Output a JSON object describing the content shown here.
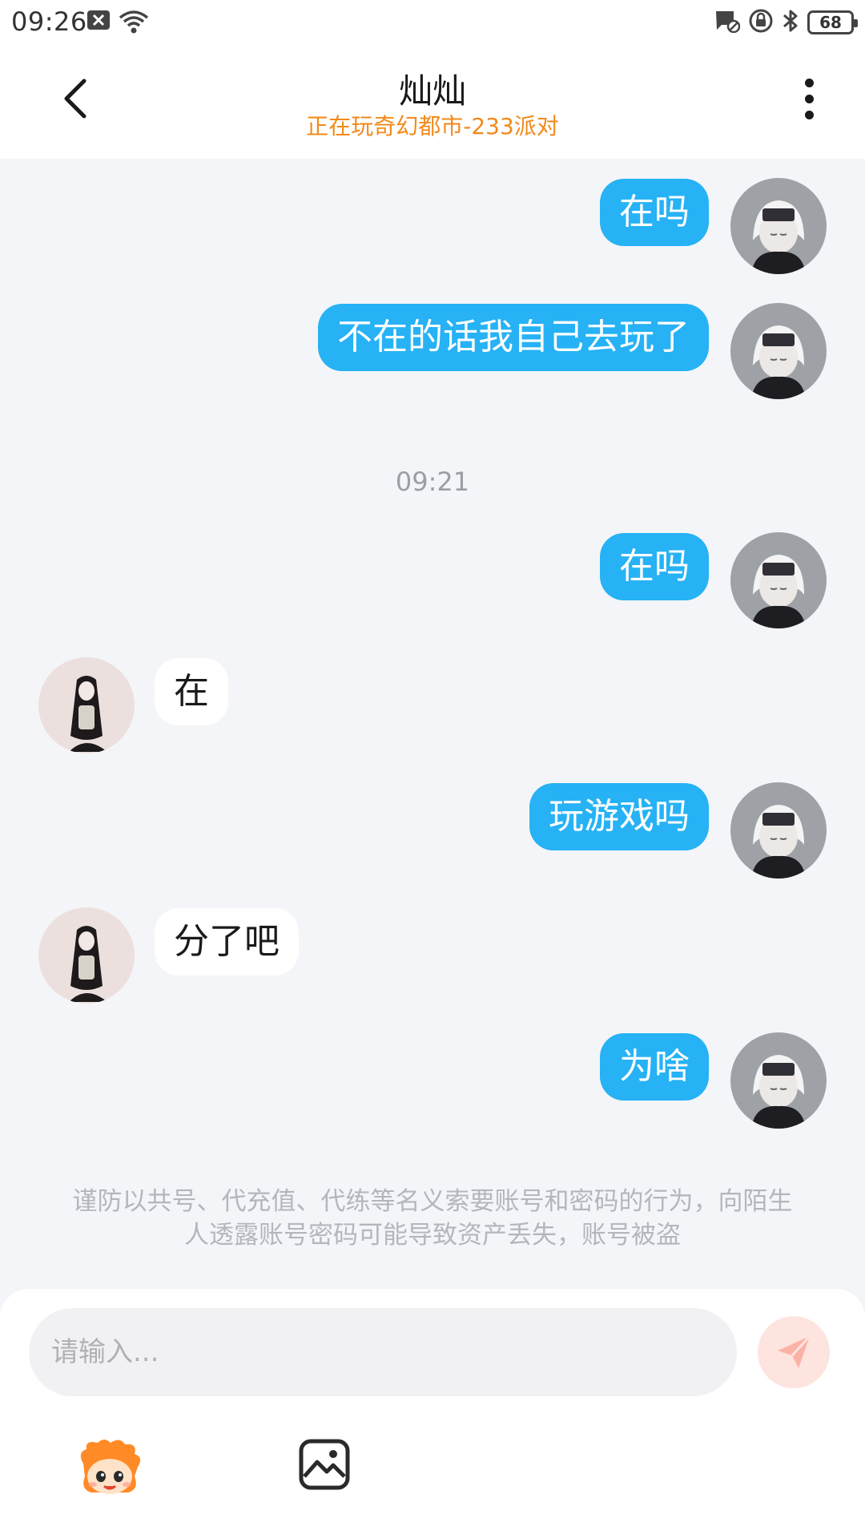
{
  "status_bar": {
    "time": "09:26",
    "battery": "68",
    "left_icons": [
      "notification-x-icon",
      "wifi-icon"
    ],
    "right_icons": [
      "message-mute-icon",
      "lock-rotation-icon",
      "bluetooth-icon",
      "battery-icon"
    ]
  },
  "header": {
    "title": "灿灿",
    "subtitle": "正在玩奇幻都市-233派对"
  },
  "messages": [
    {
      "side": "right",
      "text": "在吗"
    },
    {
      "side": "right",
      "text": "不在的话我自己去玩了"
    },
    {
      "side": "right",
      "text": "在吗"
    },
    {
      "side": "left",
      "text": "在"
    },
    {
      "side": "right",
      "text": "玩游戏吗"
    },
    {
      "side": "left",
      "text": "分了吧"
    },
    {
      "side": "right",
      "text": "为啥"
    }
  ],
  "time_divider": "09:21",
  "warning": "谨防以共号、代充值、代练等名义索要账号和密码的行为，向陌生人透露账号密码可能导致资产丢失，账号被盗",
  "input": {
    "placeholder": "请输入..."
  },
  "colors": {
    "my_bubble": "#26b2f5",
    "their_bubble": "#ffffff",
    "subtitle": "#f28a1a",
    "background": "#f4f5f8",
    "send_button": "#fde4df"
  }
}
